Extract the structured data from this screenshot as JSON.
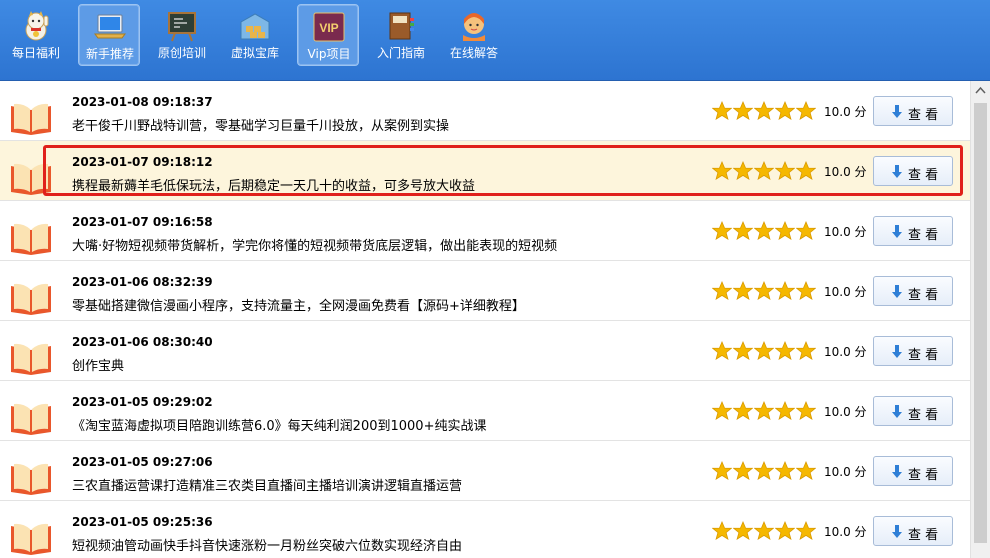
{
  "toolbar": {
    "items": [
      {
        "label": "每日福利",
        "icon": "lucky-cat-icon"
      },
      {
        "label": "新手推荐",
        "icon": "laptop-icon"
      },
      {
        "label": "原创培训",
        "icon": "blackboard-icon"
      },
      {
        "label": "虚拟宝库",
        "icon": "warehouse-icon"
      },
      {
        "label": "Vip项目",
        "icon": "vip-icon",
        "badge": "VIP"
      },
      {
        "label": "入门指南",
        "icon": "books-icon"
      },
      {
        "label": "在线解答",
        "icon": "support-agent-icon"
      }
    ]
  },
  "rows": [
    {
      "date": "2023-01-08 09:18:37",
      "title": "老干俊千川野战特训营，零基础学习巨量千川投放，从案例到实操",
      "rating": 5,
      "score": "10.0 分",
      "button": "查 看"
    },
    {
      "date": "2023-01-07 09:18:12",
      "title": "携程最新薅羊毛低保玩法，后期稳定一天几十的收益，可多号放大收益",
      "rating": 5,
      "score": "10.0 分",
      "button": "查 看"
    },
    {
      "date": "2023-01-07 09:16:58",
      "title": "大嘴·好物短视频带货解析，学完你将懂的短视频带货底层逻辑，做出能表现的短视频",
      "rating": 5,
      "score": "10.0 分",
      "button": "查 看"
    },
    {
      "date": "2023-01-06 08:32:39",
      "title": "零基础搭建微信漫画小程序，支持流量主，全网漫画免费看【源码+详细教程】",
      "rating": 5,
      "score": "10.0 分",
      "button": "查 看"
    },
    {
      "date": "2023-01-06 08:30:40",
      "title": "创作宝典",
      "rating": 5,
      "score": "10.0 分",
      "button": "查 看"
    },
    {
      "date": "2023-01-05 09:29:02",
      "title": "《淘宝蓝海虚拟项目陪跑训练营6.0》每天纯利润200到1000+纯实战课",
      "rating": 5,
      "score": "10.0 分",
      "button": "查 看"
    },
    {
      "date": "2023-01-05 09:27:06",
      "title": "三农直播运营课打造精准三农类目直播间主播培训演讲逻辑直播运营",
      "rating": 5,
      "score": "10.0 分",
      "button": "查 看"
    },
    {
      "date": "2023-01-05 09:25:36",
      "title": "短视频油管动画快手抖音快速涨粉一月粉丝突破六位数实现经济自由",
      "rating": 5,
      "score": "10.0 分",
      "button": "查 看"
    }
  ],
  "colors": {
    "toolbar": "#2d74d1",
    "star": "#f5b800",
    "highlight": "#fdf5dc",
    "focus": "#e0201b"
  }
}
